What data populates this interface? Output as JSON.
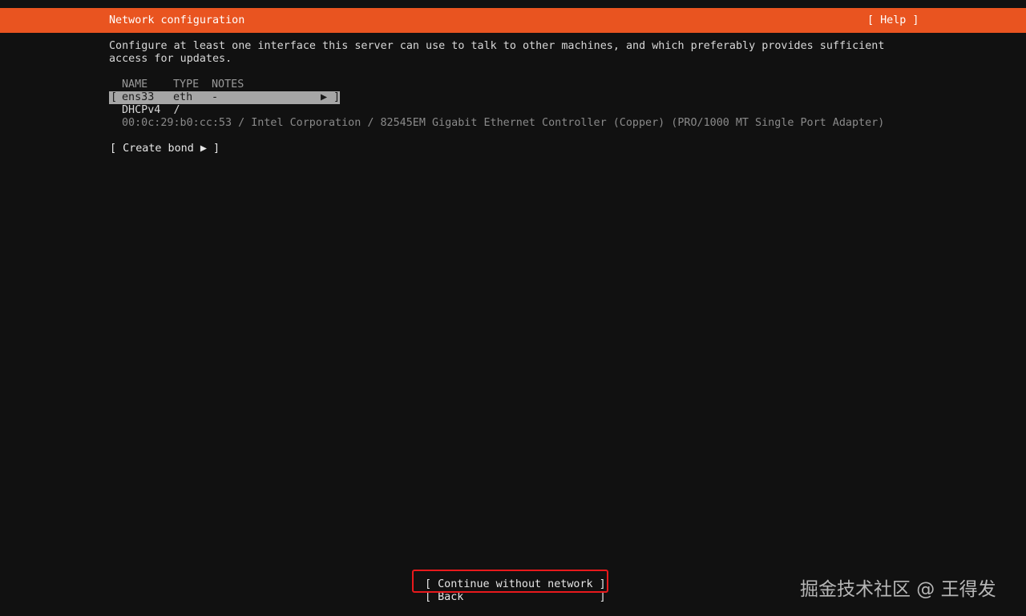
{
  "header": {
    "title": "Network configuration",
    "help_label": "[ Help ]",
    "background": "#e95420"
  },
  "intro": {
    "line1": "Configure at least one interface this server can use to talk to other machines, and which preferably provides sufficient",
    "line2": "access for updates."
  },
  "table": {
    "columns": [
      "NAME",
      "TYPE",
      "NOTES"
    ],
    "interface": {
      "name": "ens33",
      "type": "eth",
      "notes": "-",
      "open_bracket": "[",
      "close_bracket": "]",
      "arrow": "▶"
    },
    "address_line": "DHCPv4  /",
    "hardware_line": "00:0c:29:b0:cc:53 / Intel Corporation / 82545EM Gigabit Ethernet Controller (Copper) (PRO/1000 MT Single Port Adapter)"
  },
  "create_bond": {
    "label": "[ Create bond ▶ ]"
  },
  "footer": {
    "continue_label": "[ Continue without network ]",
    "back_label": "[ Back                     ]"
  },
  "watermark": {
    "text": "掘金技术社区 @ 王得发"
  }
}
